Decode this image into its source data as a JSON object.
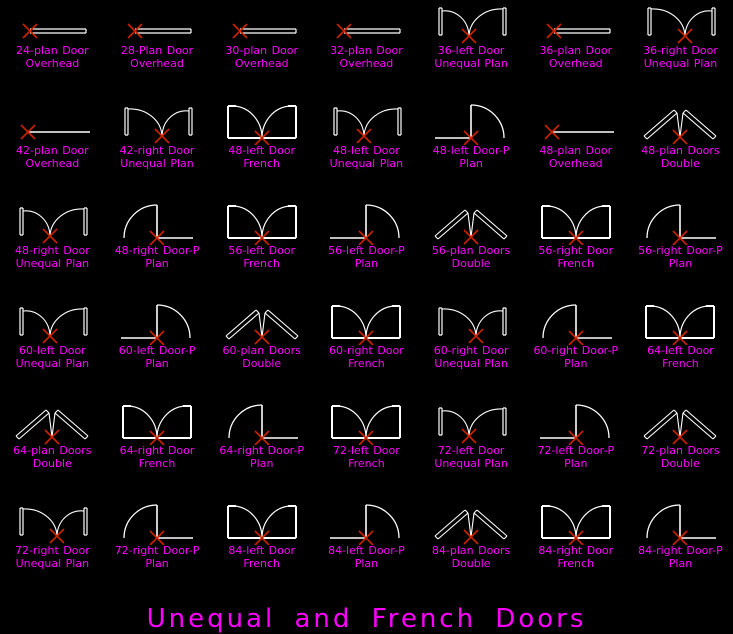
{
  "page": {
    "title": "Unequal and French Doors",
    "background_color": "#000000",
    "label_color": "#ff00ff",
    "symbol_color": "#ffffff",
    "marker_color": "#cc2200",
    "columns": 7,
    "rows": 6
  },
  "blocks": [
    {
      "name": "24-plan Door Overhead",
      "type": "overhead"
    },
    {
      "name": "28-Plan Door Overhead",
      "type": "overhead"
    },
    {
      "name": "30-plan Door Overhead",
      "type": "overhead"
    },
    {
      "name": "32-plan Door Overhead",
      "type": "overhead"
    },
    {
      "name": "36-left Door Unequal Plan",
      "type": "unequal-left"
    },
    {
      "name": "36-plan Door Overhead",
      "type": "overhead"
    },
    {
      "name": "36-right Door Unequal Plan",
      "type": "unequal-right"
    },
    {
      "name": "42-plan Door Overhead",
      "type": "overhead-single"
    },
    {
      "name": "42-right Door Unequal Plan",
      "type": "unequal-right"
    },
    {
      "name": "48-left Door French",
      "type": "french-left"
    },
    {
      "name": "48-left Door Unequal Plan",
      "type": "unequal-left"
    },
    {
      "name": "48-left Door-P Plan",
      "type": "doorp-left"
    },
    {
      "name": "48-plan Door Overhead",
      "type": "overhead-single"
    },
    {
      "name": "48-plan Doors Double",
      "type": "double"
    },
    {
      "name": "48-right Door Unequal Plan",
      "type": "unequal-left"
    },
    {
      "name": "48-right Door-P Plan",
      "type": "doorp-right"
    },
    {
      "name": "56-left Door French",
      "type": "french-left"
    },
    {
      "name": "56-left Door-P Plan",
      "type": "doorp-left"
    },
    {
      "name": "56-plan Doors Double",
      "type": "double"
    },
    {
      "name": "56-right Door French",
      "type": "french-right"
    },
    {
      "name": "56-right Door-P Plan",
      "type": "doorp-right"
    },
    {
      "name": "60-left Door Unequal Plan",
      "type": "unequal-left"
    },
    {
      "name": "60-left Door-P Plan",
      "type": "doorp-left"
    },
    {
      "name": "60-plan Doors Double",
      "type": "double"
    },
    {
      "name": "60-right Door French",
      "type": "french-right"
    },
    {
      "name": "60-right Door Unequal Plan",
      "type": "unequal-right"
    },
    {
      "name": "60-right Door-P Plan",
      "type": "doorp-right"
    },
    {
      "name": "64-left Door French",
      "type": "french-left"
    },
    {
      "name": "64-plan Doors Double",
      "type": "double"
    },
    {
      "name": "64-right Door French",
      "type": "french-right"
    },
    {
      "name": "64-right Door-P Plan",
      "type": "doorp-right"
    },
    {
      "name": "72-left Door French",
      "type": "french-left"
    },
    {
      "name": "72-left Door Unequal Plan",
      "type": "unequal-left"
    },
    {
      "name": "72-left Door-P Plan",
      "type": "doorp-left"
    },
    {
      "name": "72-plan Doors Double",
      "type": "double"
    },
    {
      "name": "72-right Door Unequal Plan",
      "type": "unequal-right"
    },
    {
      "name": "72-right Door-P Plan",
      "type": "doorp-right"
    },
    {
      "name": "84-left Door French",
      "type": "french-left"
    },
    {
      "name": "84-left Door-P Plan",
      "type": "doorp-left"
    },
    {
      "name": "84-plan Doors Double",
      "type": "double"
    },
    {
      "name": "84-right Door French",
      "type": "french-right"
    },
    {
      "name": "84-right Door-P Plan",
      "type": "doorp-right"
    }
  ]
}
